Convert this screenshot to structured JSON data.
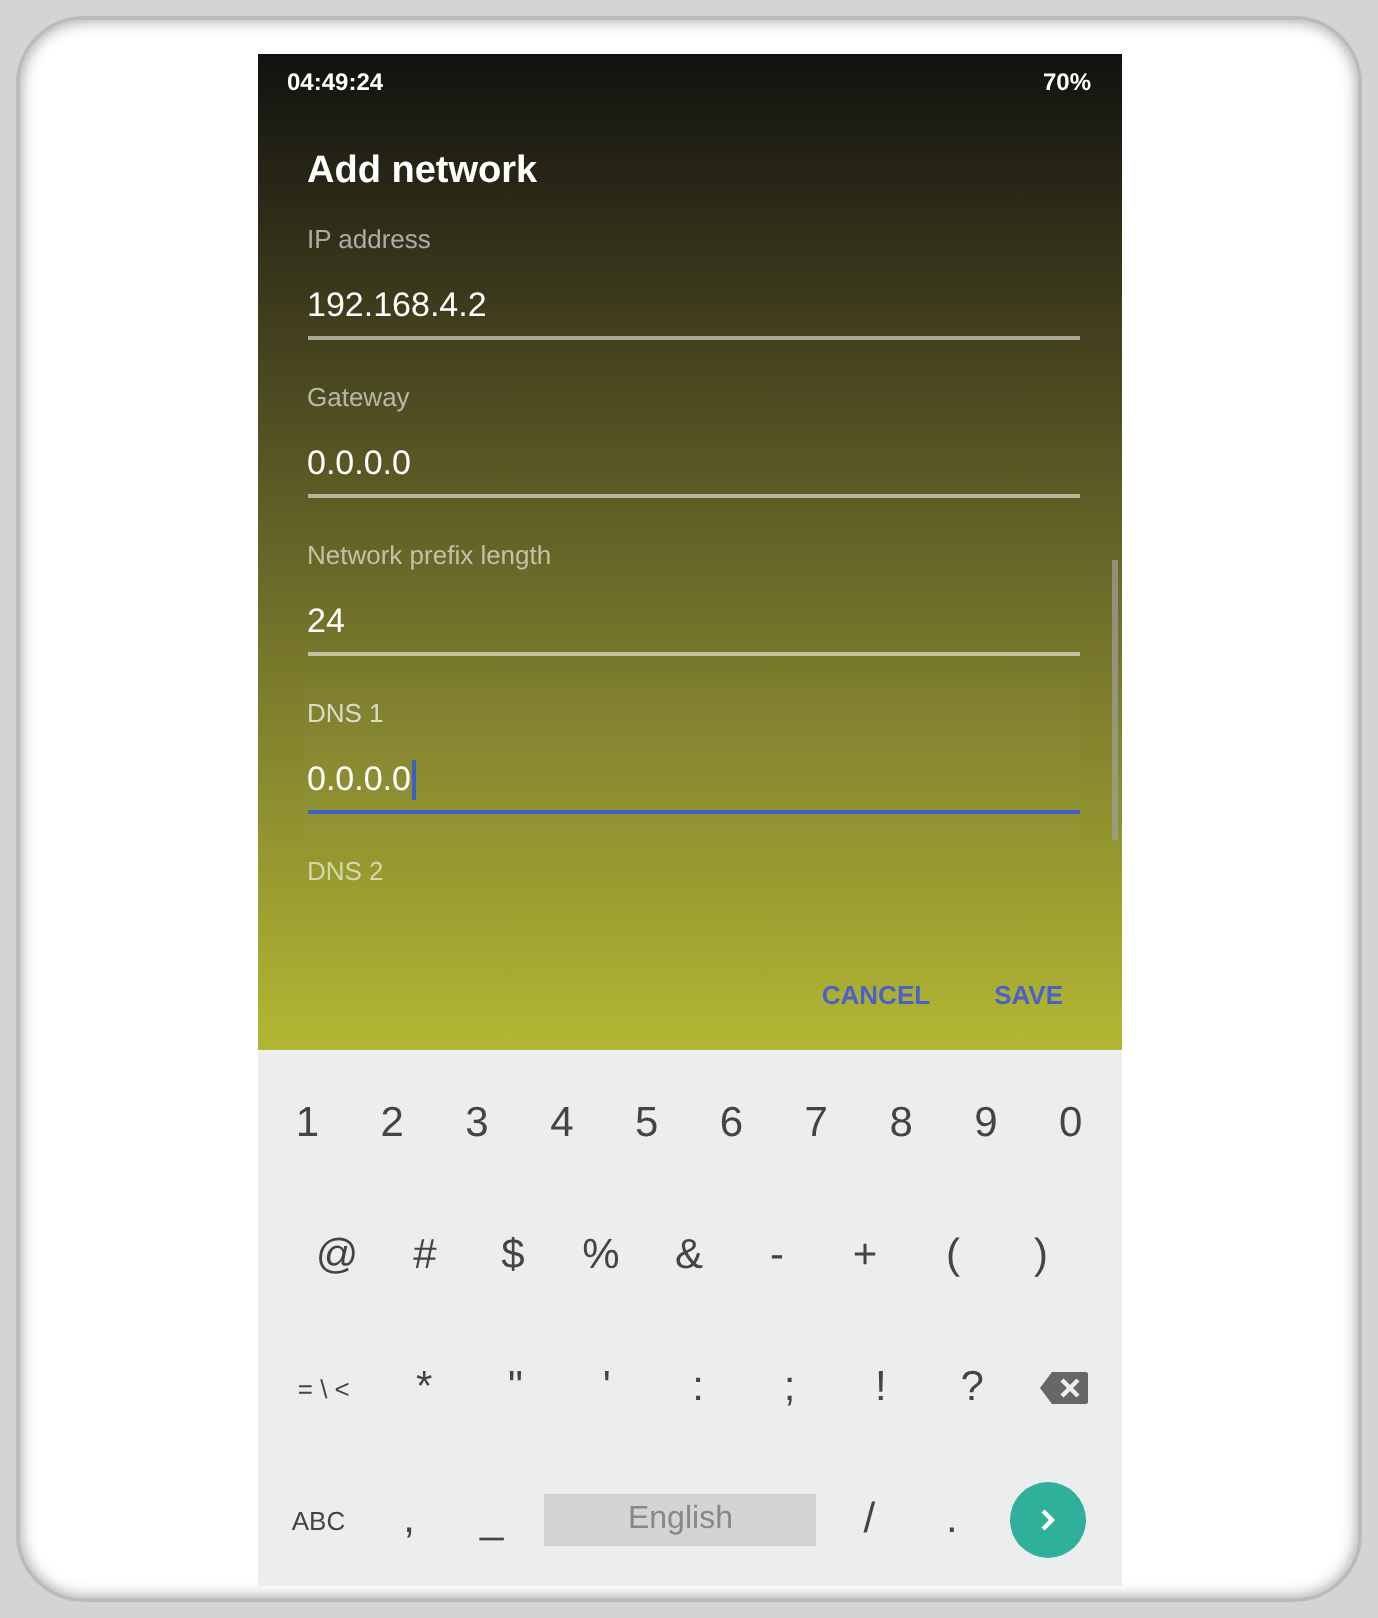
{
  "status_bar": {
    "time": "04:49:24",
    "battery": "70%"
  },
  "dialog": {
    "title": "Add network",
    "fields": [
      {
        "label": "IP address",
        "value": "192.168.4.2",
        "focused": false
      },
      {
        "label": "Gateway",
        "value": "0.0.0.0",
        "focused": false
      },
      {
        "label": "Network prefix length",
        "value": "24",
        "focused": false
      },
      {
        "label": "DNS 1",
        "value": "0.0.0.0",
        "focused": true
      },
      {
        "label": "DNS 2",
        "focused": false
      }
    ],
    "buttons": [
      "CANCEL",
      "SAVE"
    ]
  },
  "keyboard": {
    "rows": [
      {
        "keys": [
          {
            "kind": "char",
            "label": "1"
          },
          {
            "kind": "char",
            "label": "2"
          },
          {
            "kind": "char",
            "label": "3"
          },
          {
            "kind": "char",
            "label": "4"
          },
          {
            "kind": "char",
            "label": "5"
          },
          {
            "kind": "char",
            "label": "6"
          },
          {
            "kind": "char",
            "label": "7"
          },
          {
            "kind": "char",
            "label": "8"
          },
          {
            "kind": "char",
            "label": "9"
          },
          {
            "kind": "char",
            "label": "0"
          }
        ]
      },
      {
        "keys": [
          {
            "kind": "char",
            "label": "@"
          },
          {
            "kind": "char",
            "label": "#"
          },
          {
            "kind": "char",
            "label": "$"
          },
          {
            "kind": "char",
            "label": "%"
          },
          {
            "kind": "char",
            "label": "&"
          },
          {
            "kind": "char",
            "label": "-"
          },
          {
            "kind": "char",
            "label": "+"
          },
          {
            "kind": "char",
            "label": "("
          },
          {
            "kind": "char",
            "label": ")"
          }
        ]
      },
      {
        "keys": [
          {
            "kind": "mode",
            "label": "= \\ <"
          },
          {
            "kind": "char",
            "label": "*"
          },
          {
            "kind": "char",
            "label": "\""
          },
          {
            "kind": "char",
            "label": "'"
          },
          {
            "kind": "char",
            "label": ":"
          },
          {
            "kind": "char",
            "label": ";"
          },
          {
            "kind": "char",
            "label": "!"
          },
          {
            "kind": "char",
            "label": "?"
          },
          {
            "kind": "backspace"
          }
        ]
      },
      {
        "keys": [
          {
            "kind": "mode",
            "label": "ABC"
          },
          {
            "kind": "char",
            "label": ","
          },
          {
            "kind": "char",
            "label": "_"
          },
          {
            "kind": "space",
            "label": "English"
          },
          {
            "kind": "char",
            "label": "/"
          },
          {
            "kind": "char",
            "label": "."
          },
          {
            "kind": "enter"
          }
        ]
      }
    ]
  }
}
